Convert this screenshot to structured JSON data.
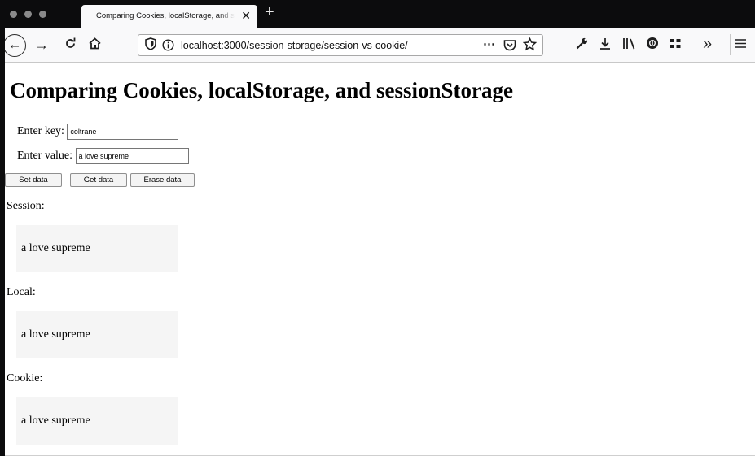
{
  "browser": {
    "tab_title": "Comparing Cookies, localStorage, and sessionStorage",
    "close_glyph": "✕",
    "new_tab_glyph": "+",
    "url": "localhost:3000/session-storage/session-vs-cookie/",
    "icons": [
      "back-icon",
      "forward-icon",
      "reload-icon",
      "home-icon",
      "shield-icon",
      "info-icon",
      "more-icon",
      "pocket-icon",
      "bookmark-star-icon",
      "wrench-icon",
      "download-icon",
      "library-icon",
      "extension-icon",
      "apps-icon",
      "overflow-icon",
      "menu-icon"
    ]
  },
  "page": {
    "heading": "Comparing Cookies, localStorage, and sessionStorage",
    "key_label": "Enter key:",
    "key_value": "coltrane",
    "value_label": "Enter value:",
    "value_value": "a love supreme",
    "buttons": {
      "set": "Set data",
      "get": "Get data",
      "erase": "Erase data"
    },
    "session_label": "Session:",
    "session_value": "a love supreme",
    "local_label": "Local:",
    "local_value": "a love supreme",
    "cookie_label": "Cookie:",
    "cookie_value": "a love supreme"
  }
}
